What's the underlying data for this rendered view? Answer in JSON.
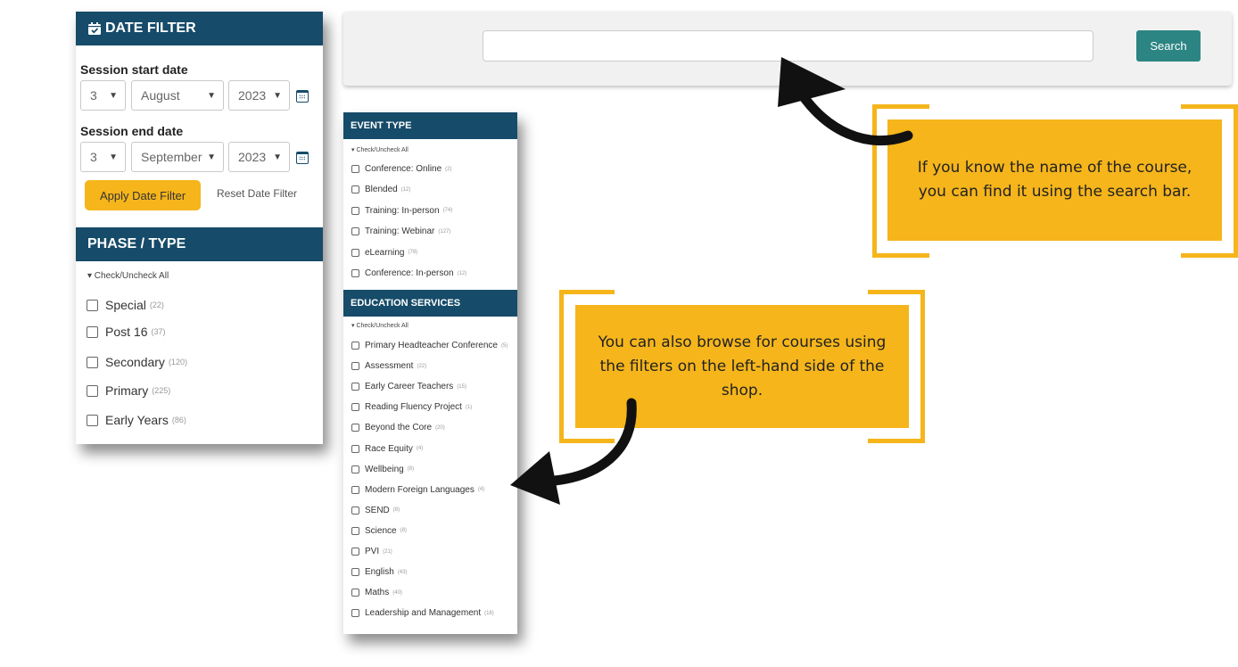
{
  "date_filter": {
    "title": "DATE FILTER",
    "start_label": "Session start date",
    "start": {
      "day": "3",
      "month": "August",
      "year": "2023"
    },
    "end_label": "Session end date",
    "end": {
      "day": "3",
      "month": "September",
      "year": "2023"
    },
    "apply_label": "Apply Date Filter",
    "reset_label": "Reset Date Filter"
  },
  "phase": {
    "title": "PHASE / TYPE",
    "toggle_all": "▾ Check/Uncheck All",
    "items": [
      {
        "label": "Special",
        "count": "(22)"
      },
      {
        "label": "Post 16",
        "count": "(37)"
      },
      {
        "label": "Secondary",
        "count": "(120)"
      },
      {
        "label": "Primary",
        "count": "(225)"
      },
      {
        "label": "Early Years",
        "count": "(86)"
      }
    ]
  },
  "search": {
    "placeholder": "",
    "button_label": "Search"
  },
  "event_type": {
    "title": "EVENT TYPE",
    "toggle_all": "▾ Check/Uncheck All",
    "items": [
      {
        "label": "Conference: Online",
        "count": "(2)"
      },
      {
        "label": "Blended",
        "count": "(12)"
      },
      {
        "label": "Training: In-person",
        "count": "(74)"
      },
      {
        "label": "Training: Webinar",
        "count": "(127)"
      },
      {
        "label": "eLearning",
        "count": "(78)"
      },
      {
        "label": "Conference: In-person",
        "count": "(12)"
      }
    ]
  },
  "education_services": {
    "title": "EDUCATION SERVICES",
    "toggle_all": "▾ Check/Uncheck All",
    "items": [
      {
        "label": "Primary Headteacher Conference",
        "count": "(5)"
      },
      {
        "label": "Assessment",
        "count": "(22)"
      },
      {
        "label": "Early Career Teachers",
        "count": "(15)"
      },
      {
        "label": "Reading Fluency Project",
        "count": "(1)"
      },
      {
        "label": "Beyond the Core",
        "count": "(20)"
      },
      {
        "label": "Race Equity",
        "count": "(4)"
      },
      {
        "label": "Wellbeing",
        "count": "(8)"
      },
      {
        "label": "Modern Foreign Languages",
        "count": "(4)"
      },
      {
        "label": "SEND",
        "count": "(8)"
      },
      {
        "label": "Science",
        "count": "(8)"
      },
      {
        "label": "PVI",
        "count": "(21)"
      },
      {
        "label": "English",
        "count": "(43)"
      },
      {
        "label": "Maths",
        "count": "(40)"
      },
      {
        "label": "Leadership and Management",
        "count": "(18)"
      }
    ]
  },
  "callouts": {
    "search_text": "If you know the name of the course, you can find it using the search bar.",
    "filters_text": "You can also browse for courses using the filters on the left-hand side of the shop."
  },
  "colors": {
    "header_navy": "#164b69",
    "accent_yellow": "#f5b51b",
    "search_teal": "#2c8583"
  },
  "icons": [
    "calendar-check-icon",
    "calendar-icon",
    "chevron-down-icon",
    "checkbox-icon",
    "curved-arrow-icon"
  ]
}
